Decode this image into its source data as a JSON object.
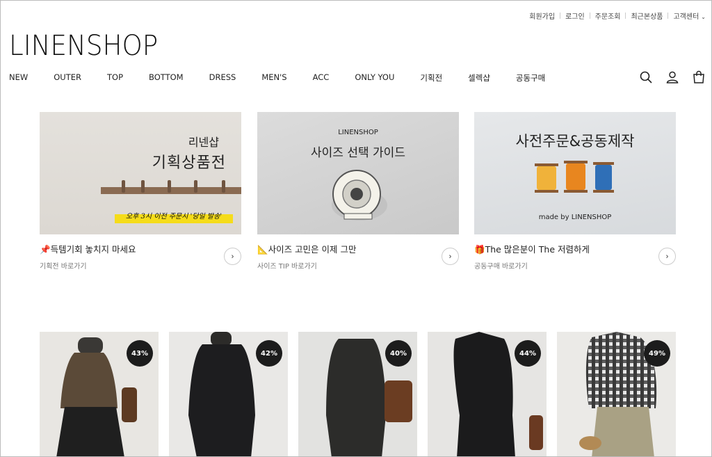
{
  "util_nav": [
    {
      "label": "회원가입"
    },
    {
      "label": "로그인"
    },
    {
      "label": "주문조회"
    },
    {
      "label": "최근본상품"
    },
    {
      "label": "고객센터"
    }
  ],
  "logo": "LINENSHOP",
  "nav": [
    {
      "label": "NEW"
    },
    {
      "label": "OUTER"
    },
    {
      "label": "TOP"
    },
    {
      "label": "BOTTOM"
    },
    {
      "label": "DRESS"
    },
    {
      "label": "MEN'S"
    },
    {
      "label": "ACC"
    },
    {
      "label": "ONLY YOU"
    },
    {
      "label": "기획전"
    },
    {
      "label": "셀렉샵"
    },
    {
      "label": "공동구매"
    }
  ],
  "header_icons": [
    "search-icon",
    "user-icon",
    "cart-icon"
  ],
  "banners": [
    {
      "img_small": "리넨샵",
      "img_big": "기획상품전",
      "img_note": "오후 3시 이전 주문시 '당일 발송'",
      "emoji": "📌",
      "title": "득템기회 놓치지 마세요",
      "subtitle": "기획전 바로가기"
    },
    {
      "img_small": "LINENSHOP",
      "img_big": "사이즈 선택 가이드",
      "emoji": "📐",
      "title": "사이즈 고민은 이제 그만",
      "subtitle": "사이즈 TIP 바로가기"
    },
    {
      "img_big": "사전주문&공동제작",
      "img_small": "made by LINENSHOP",
      "emoji": "🎁",
      "title": "The 많은분이 The 저렴하게",
      "subtitle": "공동구매 바로가기"
    }
  ],
  "products": [
    {
      "discount": "43%"
    },
    {
      "discount": "42%"
    },
    {
      "discount": "40%"
    },
    {
      "discount": "44%"
    },
    {
      "discount": "49%"
    }
  ],
  "colors": {
    "accent_yellow": "#f5dc1a",
    "badge_bg": "#1c1c1c"
  }
}
